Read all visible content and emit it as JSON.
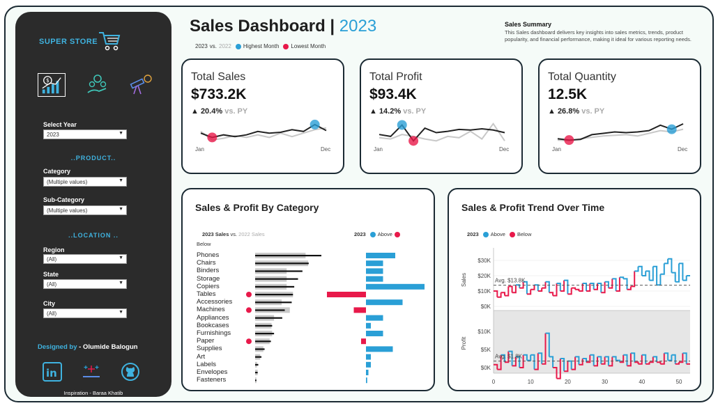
{
  "sidebar": {
    "brand": "SUPER STORE",
    "select_year_label": "Select Year",
    "select_year_value": "2023",
    "product_section": "..PRODUCT..",
    "category_label": "Category",
    "category_value": "(Multiple values)",
    "subcategory_label": "Sub-Category",
    "subcategory_value": "(Multiple values)",
    "location_section": "..LOCATION ..",
    "region_label": "Region",
    "region_value": "(All)",
    "state_label": "State",
    "state_value": "(All)",
    "city_label": "City",
    "city_value": "(All)",
    "designed_prefix": "Designed by",
    "designed_name": "- Olumide Balogun",
    "inspiration": "Inspiration - Baraa Khatib"
  },
  "header": {
    "title": "Sales Dashboard | ",
    "year": "2023",
    "legend_2023": "2023",
    "legend_vs": "vs.",
    "legend_2022": "2022",
    "legend_highest": "Highest Month",
    "legend_lowest": "Lowest Month"
  },
  "summary": {
    "heading": "Sales Summary",
    "text": "This Sales dashboard delivers key insights into sales metrics, trends, product popularity, and financial performance, making it ideal for various reporting needs."
  },
  "colors": {
    "accent": "#2a9fd6",
    "above": "#2a9fd6",
    "below": "#e8194a",
    "sidebar": "#2b2b2b"
  },
  "kpis": [
    {
      "title": "Total Sales",
      "value": "$733.2K",
      "delta": "▲ 20.4%",
      "vs": "vs. PY",
      "start_label": "Jan",
      "end_label": "Dec",
      "current": [
        60,
        55,
        58,
        56,
        58,
        62,
        60,
        61,
        64,
        62,
        70,
        63
      ],
      "previous": [
        62,
        52,
        54,
        57,
        55,
        58,
        55,
        60,
        56,
        60,
        64,
        66
      ],
      "low_index": 1,
      "high_index": 10
    },
    {
      "title": "Total Profit",
      "value": "$93.4K",
      "delta": "▲ 14.2%",
      "vs": "vs. PY",
      "start_label": "Jan",
      "end_label": "Dec",
      "current": [
        55,
        52,
        70,
        45,
        65,
        58,
        60,
        63,
        62,
        64,
        62,
        58
      ],
      "previous": [
        50,
        48,
        55,
        52,
        48,
        45,
        52,
        50,
        60,
        48,
        72,
        45
      ],
      "low_index": 3,
      "high_index": 2
    },
    {
      "title": "Total Quantity",
      "value": "12.5K",
      "delta": "▲ 26.8%",
      "vs": "vs. PY",
      "start_label": "Jan",
      "end_label": "Dec",
      "current": [
        52,
        50,
        51,
        58,
        60,
        62,
        61,
        62,
        64,
        72,
        66,
        74
      ],
      "previous": [
        50,
        49,
        52,
        54,
        56,
        57,
        58,
        56,
        60,
        64,
        62,
        66
      ],
      "low_index": 1,
      "high_index": 10
    }
  ],
  "category_panel": {
    "title": "Sales & Profit By Category",
    "legend_sales_2023": "2023 Sales",
    "legend_vs": "vs.",
    "legend_sales_2022": "2022 Sales",
    "legend_2023": "2023",
    "legend_above": "Above",
    "legend_below": "Below"
  },
  "trend_panel": {
    "title": "Sales & Profit Trend Over Time",
    "legend_2023": "2023",
    "legend_above": "Above",
    "legend_below": "Below",
    "sales_axis_label": "Sales",
    "profit_axis_label": "Profit",
    "sales_avg_label": "Avg. $13.8K",
    "profit_avg_label": "Avg. $1.8K",
    "sales_ticks": [
      "$30K",
      "$20K",
      "$10K",
      "$0K"
    ],
    "profit_ticks": [
      "$10K",
      "$5K",
      "$0K"
    ],
    "x_ticks": [
      "0",
      "10",
      "20",
      "30",
      "40",
      "50"
    ]
  },
  "chart_data": [
    {
      "type": "bar",
      "title": "Sales & Profit By Category",
      "categories": [
        "Phones",
        "Chairs",
        "Binders",
        "Storage",
        "Copiers",
        "Tables",
        "Accessories",
        "Machines",
        "Appliances",
        "Bookcases",
        "Furnishings",
        "Paper",
        "Supplies",
        "Art",
        "Labels",
        "Envelopes",
        "Fasteners"
      ],
      "series": [
        {
          "name": "2023 Sales",
          "values": [
            105,
            85,
            75,
            68,
            62,
            60,
            58,
            47,
            43,
            27,
            30,
            25,
            15,
            10,
            5,
            4,
            2
          ]
        },
        {
          "name": "2022 Sales",
          "values": [
            80,
            84,
            50,
            50,
            50,
            60,
            42,
            55,
            30,
            26,
            27,
            23,
            13,
            8,
            3,
            4,
            2
          ]
        },
        {
          "name": "2023",
          "values": [
            12,
            7,
            7,
            7,
            24,
            -16,
            15,
            -5,
            7,
            2,
            7,
            -2,
            11,
            2,
            2,
            1,
            0.5
          ]
        }
      ]
    },
    {
      "type": "line",
      "title": "Sales & Profit Trend Over Time",
      "x": [
        0,
        1,
        2,
        3,
        4,
        5,
        6,
        7,
        8,
        9,
        10,
        11,
        12,
        13,
        14,
        15,
        16,
        17,
        18,
        19,
        20,
        21,
        22,
        23,
        24,
        25,
        26,
        27,
        28,
        29,
        30,
        31,
        32,
        33,
        34,
        35,
        36,
        37,
        38,
        39,
        40,
        41,
        42,
        43,
        44,
        45,
        46,
        47,
        48,
        49,
        50,
        51,
        52
      ],
      "series": [
        {
          "name": "Sales",
          "values": [
            10,
            6,
            9,
            7,
            13,
            9,
            14,
            12,
            16,
            8,
            11,
            14,
            10,
            12,
            16,
            9,
            7,
            15,
            10,
            17,
            8,
            12,
            11,
            10,
            15,
            10,
            15,
            11,
            15,
            9,
            16,
            12,
            18,
            10,
            19,
            18,
            11,
            13,
            23,
            26,
            20,
            23,
            17,
            26,
            14,
            21,
            28,
            31,
            22,
            16,
            28,
            17,
            20
          ],
          "avg": 13.8
        },
        {
          "name": "Profit",
          "values": [
            0.8,
            -0.5,
            3.5,
            1.5,
            4.5,
            0.5,
            3.0,
            0.0,
            3.5,
            2.0,
            3.5,
            -0.5,
            4.0,
            1.0,
            9.5,
            3.0,
            0.0,
            -3.0,
            2.5,
            -1.0,
            1.8,
            -0.5,
            3.0,
            0.8,
            2.5,
            1.5,
            3.5,
            0.5,
            3.0,
            1.0,
            3.0,
            0.5,
            3.0,
            2.0,
            1.5,
            3.5,
            0.5,
            4.0,
            1.5,
            1.0,
            3.5,
            1.0,
            1.5,
            3.0,
            1.5,
            1.0,
            4.0,
            2.0,
            3.5,
            1.0,
            1.5,
            4.0,
            1.0
          ],
          "avg": 1.8
        }
      ],
      "xlim": [
        0,
        53
      ],
      "ylim": [
        0,
        35
      ]
    }
  ]
}
